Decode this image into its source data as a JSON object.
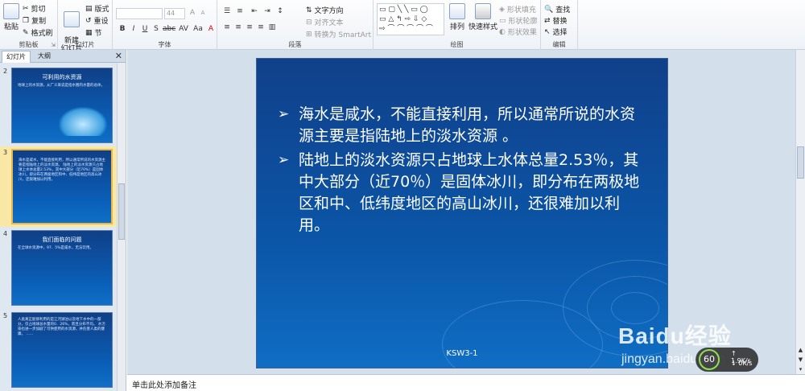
{
  "ribbon": {
    "clipboard": {
      "paste": "粘贴",
      "cut": "剪切",
      "copy": "复制",
      "format_painter": "格式刷",
      "label": "剪贴板"
    },
    "slides": {
      "new_slide": "新建\n幻灯片",
      "layout": "版式",
      "reset": "重设",
      "section": "节",
      "label": "幻灯片"
    },
    "font": {
      "font_size": "44",
      "label": "字体"
    },
    "paragraph": {
      "text_direction": "文字方向",
      "align_text": "对齐文本",
      "smartart": "转换为 SmartArt",
      "label": "段落"
    },
    "drawing": {
      "arrange": "排列",
      "quick_styles": "快速样式",
      "shape_fill": "形状填充",
      "shape_outline": "形状轮廓",
      "shape_effects": "形状效果",
      "label": "绘图"
    },
    "editing": {
      "find": "查找",
      "replace": "替换",
      "select": "选择",
      "label": "编辑"
    }
  },
  "left_pane": {
    "tab_slides": "幻灯片",
    "tab_outline": "大纲",
    "thumbnails": [
      {
        "num": "2",
        "title": "可利用的水资源",
        "body": "地球上的水资源，从广义来说是指水圈内水量的总体。"
      },
      {
        "num": "3",
        "title": "",
        "body": "海水是咸水，不能直接利用，所以通常所说的水资源主要是指陆地上的淡水资源。 陆地上的淡水资源只占地球上水体总量2.53%，其中大部分（近70%）是固体冰川，即分布在两极地区和中、低纬度地区的高山冰川，还很难加以利用。"
      },
      {
        "num": "4",
        "title": "我们面临的问题",
        "body": "在全球水资源中，97．5%是咸水，无法饮用。"
      },
      {
        "num": "5",
        "title": "",
        "body": "人类真正能够利用的是江河湖泊以及地下水中的一部分，仅占地球总水量的0．26%，而且分布不均。 水污染也进一步加剧了可供使用的水资源，并危害人类的健康。 ……"
      }
    ]
  },
  "slide": {
    "bullets": [
      "海水是咸水，不能直接利用，所以通常所说的水资源主要是指陆地上的淡水资源 。",
      "陆地上的淡水资源只占地球上水体总量2.53％，其中大部分（近70％）是固体冰川，即分布在两极地区和中、低纬度地区的高山冰川，还很难加以利用。"
    ],
    "footer": "KSW3-1"
  },
  "notes_placeholder": "单击此处添加备注",
  "watermark": {
    "brand": "Baidu经验",
    "url": "jingyan.baidu.com"
  },
  "net_widget": {
    "gauge": "60",
    "up": "1.9K/s",
    "down": "0K/s"
  }
}
